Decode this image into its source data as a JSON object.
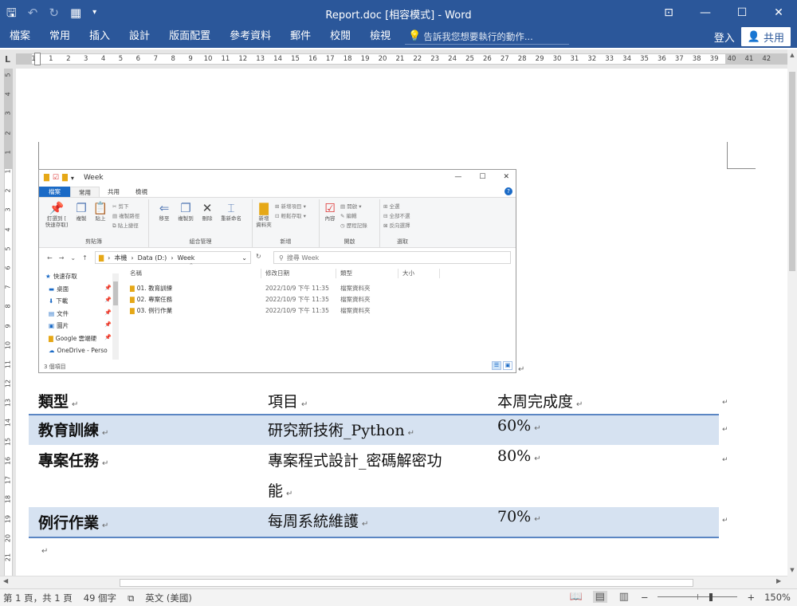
{
  "titlebar": {
    "title": "Report.doc [相容模式] - Word",
    "restore_icon": "ribbon-display-icon",
    "minimize": "—",
    "maximize": "☐",
    "close": "✕"
  },
  "ribbon": {
    "tabs": [
      "檔案",
      "常用",
      "插入",
      "設計",
      "版面配置",
      "參考資料",
      "郵件",
      "校閱",
      "檢視"
    ],
    "tell_me": "告訴我您想要執行的動作...",
    "sign_in": "登入",
    "share": "共用"
  },
  "ruler": {
    "corner": "L",
    "h_numbers": [
      "1",
      "1",
      "2",
      "3",
      "4",
      "5",
      "6",
      "7",
      "8",
      "9",
      "10",
      "11",
      "12",
      "13",
      "14",
      "15",
      "16",
      "17",
      "18",
      "19",
      "20",
      "21",
      "22",
      "23",
      "24",
      "25",
      "26",
      "27",
      "28",
      "29",
      "30",
      "31",
      "32",
      "33",
      "34",
      "35",
      "36",
      "37",
      "38",
      "39",
      "40",
      "41",
      "42"
    ],
    "v_numbers": [
      "5",
      "4",
      "3",
      "2",
      "1",
      "1",
      "2",
      "3",
      "4",
      "5",
      "6",
      "7",
      "8",
      "9",
      "10",
      "11",
      "12",
      "13",
      "14",
      "15",
      "16",
      "17",
      "18",
      "19",
      "20",
      "21"
    ]
  },
  "explorer": {
    "title": "Week",
    "controls": [
      "—",
      "☐",
      "✕"
    ],
    "tabs": [
      "檔案",
      "常用",
      "共用",
      "檢視"
    ],
    "groups": [
      {
        "label": "剪貼簿"
      },
      {
        "label": "組合管理"
      },
      {
        "label": "新增"
      },
      {
        "label": "開啟"
      },
      {
        "label": "選取"
      }
    ],
    "buttons": {
      "pin": "釘選到 [\n快速存取]",
      "copy": "複製",
      "paste": "貼上",
      "cut": "剪下",
      "copy_path": "複製路徑",
      "paste_shortcut": "貼上捷徑",
      "move_to": "移至",
      "copy_to": "複製到",
      "delete": "刪除",
      "rename": "重新命名",
      "new_folder": "新增\n資料夾",
      "new_item": "新增項目 ▾",
      "easy_access": "輕鬆存取 ▾",
      "properties": "內容",
      "open": "開啟 ▾",
      "edit": "編輯",
      "history": "歷程記錄",
      "select_all": "全選",
      "select_none": "全部不選",
      "invert": "反向選擇"
    },
    "address": {
      "path": [
        "本機",
        "Data (D:)",
        "Week"
      ],
      "search_placeholder": "搜尋 Week"
    },
    "nav": [
      {
        "label": "快速存取",
        "pinned": false
      },
      {
        "label": "桌面",
        "pinned": true
      },
      {
        "label": "下載",
        "pinned": true
      },
      {
        "label": "文件",
        "pinned": true
      },
      {
        "label": "圖片",
        "pinned": true
      },
      {
        "label": "Google 雲端硬",
        "pinned": true
      },
      {
        "label": "OneDrive - Perso",
        "pinned": false
      }
    ],
    "columns": [
      "名稱",
      "修改日期",
      "類型",
      "大小"
    ],
    "rows": [
      {
        "name": "01. 教育訓練",
        "date": "2022/10/9 下午 11:35",
        "type": "檔案資料夾"
      },
      {
        "name": "02. 專案任務",
        "date": "2022/10/9 下午 11:35",
        "type": "檔案資料夾"
      },
      {
        "name": "03. 例行作業",
        "date": "2022/10/9 下午 11:35",
        "type": "檔案資料夾"
      }
    ],
    "status": "3 個項目"
  },
  "table": {
    "header": [
      "類型",
      "項目",
      "本周完成度"
    ],
    "rows": [
      {
        "type": "教育訓練",
        "item": "研究新技術_Python",
        "item2": "",
        "progress": "60%"
      },
      {
        "type": "專案任務",
        "item": "專案程式設計_密碼解密功",
        "item2": "能",
        "progress": "80%"
      },
      {
        "type": "例行作業",
        "item": "每周系統維護",
        "item2": "",
        "progress": "70%"
      }
    ]
  },
  "statusbar": {
    "page": "第 1 頁，共 1 頁",
    "words": "49 個字",
    "language": "英文 (美國)",
    "zoom": "150%",
    "zoom_level_fraction": 0.67
  },
  "colors": {
    "ribbon": "#2b579a",
    "table_shade": "#d6e2f1",
    "table_line": "#5b86c3"
  }
}
